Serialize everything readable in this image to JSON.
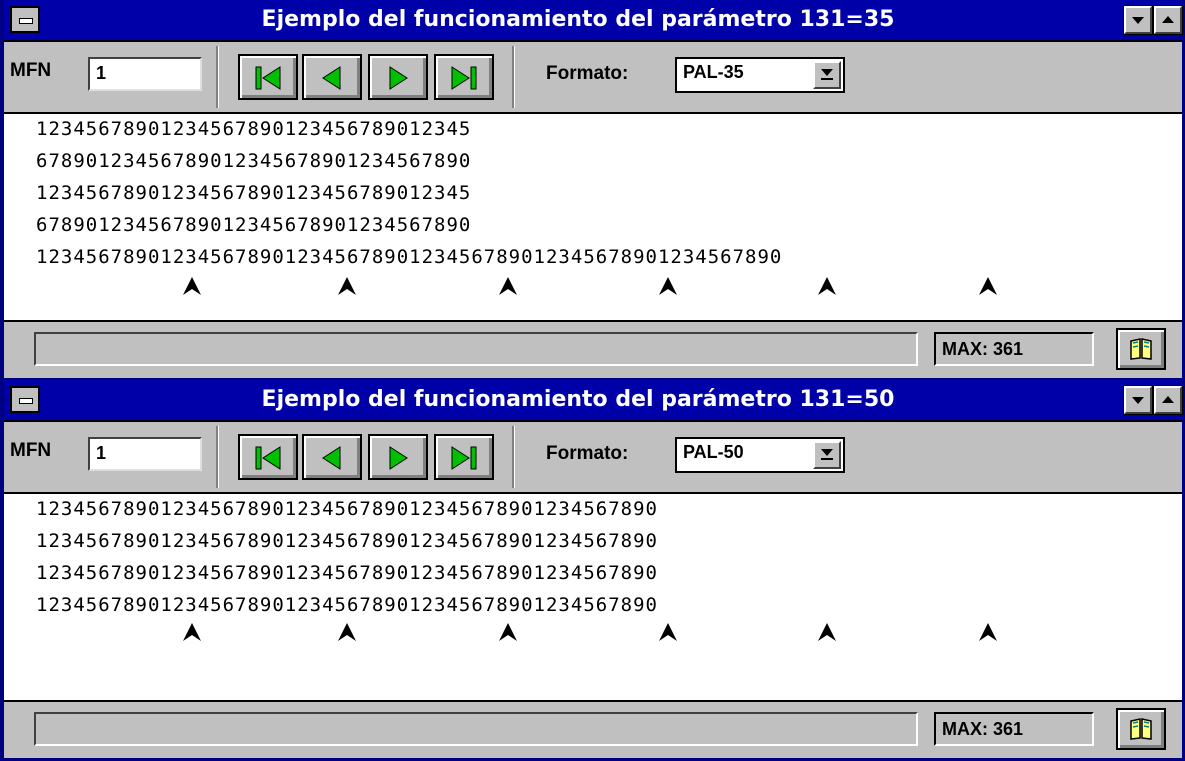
{
  "windows": [
    {
      "title": "Ejemplo del funcionamiento del parámetro 131=35",
      "mfn_label": "MFN",
      "mfn_value": "1",
      "format_label": "Formato:",
      "format_value": "PAL-35",
      "lines": [
        "12345678901234567890123456789012345",
        "67890123456789012345678901234567890",
        "12345678901234567890123456789012345",
        "67890123456789012345678901234567890",
        "123456789012345678901234567890123456789012345678901234567890"
      ],
      "max_label": "MAX: 361"
    },
    {
      "title": "Ejemplo del funcionamiento del parámetro 131=50",
      "mfn_label": "MFN",
      "mfn_value": "1",
      "format_label": "Formato:",
      "format_value": "PAL-50",
      "lines": [
        "12345678901234567890123456789012345678901234567890",
        "12345678901234567890123456789012345678901234567890",
        "12345678901234567890123456789012345678901234567890",
        "12345678901234567890123456789012345678901234567890"
      ],
      "max_label": "MAX: 361"
    }
  ],
  "icons": {
    "system_menu": "system-menu-icon",
    "minimize": "minimize-arrow-icon",
    "maximize": "maximize-arrow-icon",
    "first": "first-record-icon",
    "previous": "previous-record-icon",
    "next": "next-record-icon",
    "last": "last-record-icon",
    "dropdown": "dropdown-arrow-icon",
    "marker": "position-marker-icon",
    "book": "open-book-icon"
  },
  "colors": {
    "titlebar": "#0000a8",
    "title_text": "#ffffff",
    "chrome": "#c0c0c0",
    "nav_arrow": "#00c000"
  }
}
